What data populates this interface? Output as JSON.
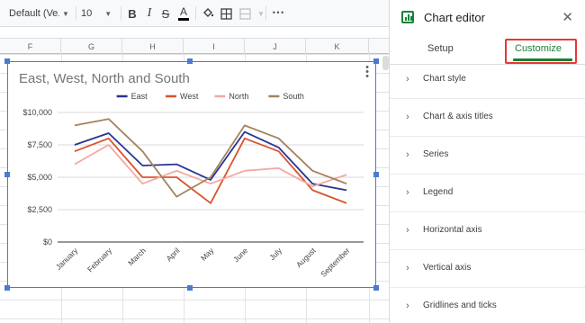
{
  "toolbar": {
    "font_name": "Default (Ve...",
    "font_size": "10",
    "bold": "B",
    "italic": "I",
    "strike": "S",
    "text_color": "A",
    "more": "⋯"
  },
  "columns": [
    "F",
    "G",
    "H",
    "I",
    "J",
    "K"
  ],
  "chart_data": {
    "type": "line",
    "title": "East, West, North and South",
    "categories": [
      "January",
      "February",
      "March",
      "April",
      "May",
      "June",
      "July",
      "August",
      "September"
    ],
    "ylim": [
      0,
      10000
    ],
    "y_ticks": [
      "$0",
      "$2,500",
      "$5,000",
      "$7,500",
      "$10,000"
    ],
    "y_tick_values": [
      0,
      2500,
      5000,
      7500,
      10000
    ],
    "legend_position": "top",
    "grid": true,
    "series": [
      {
        "name": "East",
        "color": "#283593",
        "values": [
          7500,
          8400,
          5900,
          6000,
          4800,
          8500,
          7300,
          4500,
          4000
        ]
      },
      {
        "name": "West",
        "color": "#d9542b",
        "values": [
          7000,
          8000,
          5000,
          5000,
          3000,
          8000,
          7000,
          4000,
          3000
        ]
      },
      {
        "name": "North",
        "color": "#f4a8a0",
        "values": [
          6000,
          7500,
          4500,
          5500,
          4500,
          5500,
          5700,
          4300,
          5200
        ]
      },
      {
        "name": "South",
        "color": "#a3835f",
        "values": [
          9000,
          9500,
          7000,
          3500,
          5000,
          9000,
          8000,
          5500,
          4500
        ]
      }
    ]
  },
  "panel": {
    "title": "Chart editor",
    "close": "✕",
    "tabs": {
      "setup": "Setup",
      "customize": "Customize"
    },
    "sections": [
      "Chart style",
      "Chart & axis titles",
      "Series",
      "Legend",
      "Horizontal axis",
      "Vertical axis",
      "Gridlines and ticks"
    ]
  },
  "colors": {
    "accent_green": "#188038",
    "selection_blue": "#4a7bd0",
    "highlight_red": "#e53935"
  }
}
